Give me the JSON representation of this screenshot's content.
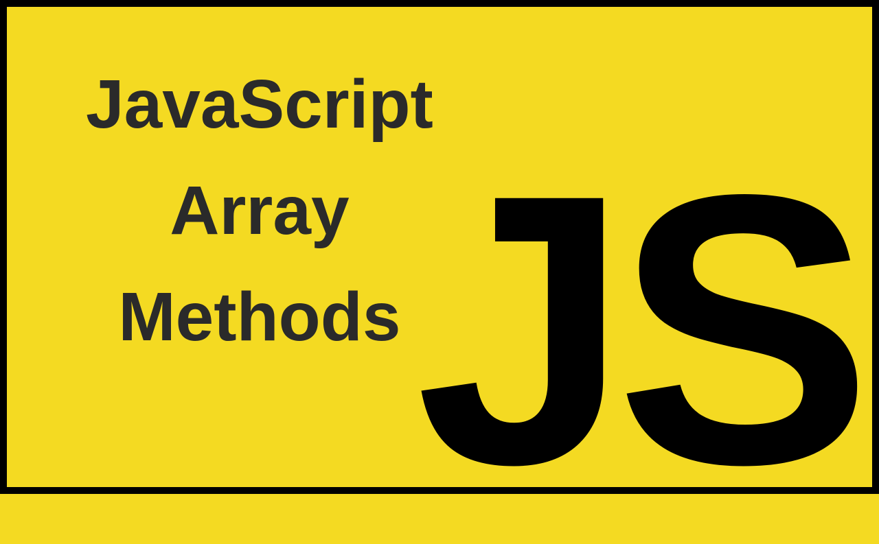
{
  "title": {
    "line1": "JavaScript",
    "line2": "Array",
    "line3": "Methods"
  },
  "logo": {
    "text": "JS"
  },
  "colors": {
    "background": "#f4da22",
    "border": "#000000",
    "title_text": "#2a2a2a",
    "logo_text": "#000000"
  }
}
